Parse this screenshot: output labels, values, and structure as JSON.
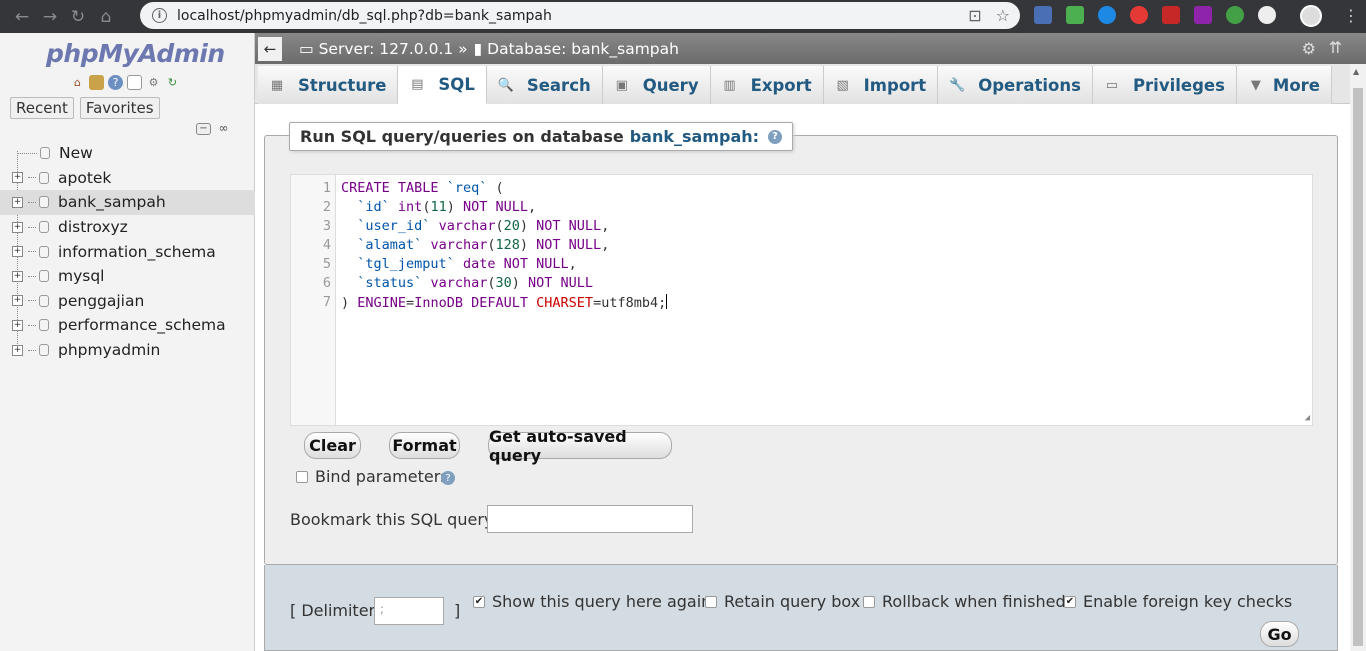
{
  "browser": {
    "url": "localhost/phpmyadmin/db_sql.php?db=bank_sampah"
  },
  "nav": {
    "logo_a": "php",
    "logo_b": "MyAdmin",
    "recent": "Recent",
    "favorites": "Favorites",
    "new_label": "New",
    "databases": [
      "apotek",
      "bank_sampah",
      "distroxyz",
      "information_schema",
      "mysql",
      "penggajian",
      "performance_schema",
      "phpmyadmin"
    ],
    "selected": "bank_sampah"
  },
  "topbar": {
    "server": "Server: 127.0.0.1 »",
    "database": "Database: bank_sampah"
  },
  "tabs": [
    "Structure",
    "SQL",
    "Search",
    "Query",
    "Export",
    "Import",
    "Operations",
    "Privileges",
    "More"
  ],
  "active_tab": "SQL",
  "query": {
    "legend": "Run SQL query/queries on database",
    "db": "bank_sampah:",
    "lines": [
      "1",
      "2",
      "3",
      "4",
      "5",
      "6",
      "7"
    ]
  },
  "buttons": {
    "clear": "Clear",
    "format": "Format",
    "autosaved": "Get auto-saved query",
    "go": "Go"
  },
  "options": {
    "bind_params": "Bind parameters",
    "bookmark_label": "Bookmark this SQL query:",
    "delimiter_label": "[ Delimiter",
    "delimiter_close": "]",
    "delimiter_value": ";",
    "show_again": "Show this query here again",
    "retain": "Retain query box",
    "rollback": "Rollback when finished",
    "foreign_keys": "Enable foreign key checks",
    "show_again_checked": true,
    "retain_checked": false,
    "rollback_checked": false,
    "foreign_keys_checked": true
  }
}
